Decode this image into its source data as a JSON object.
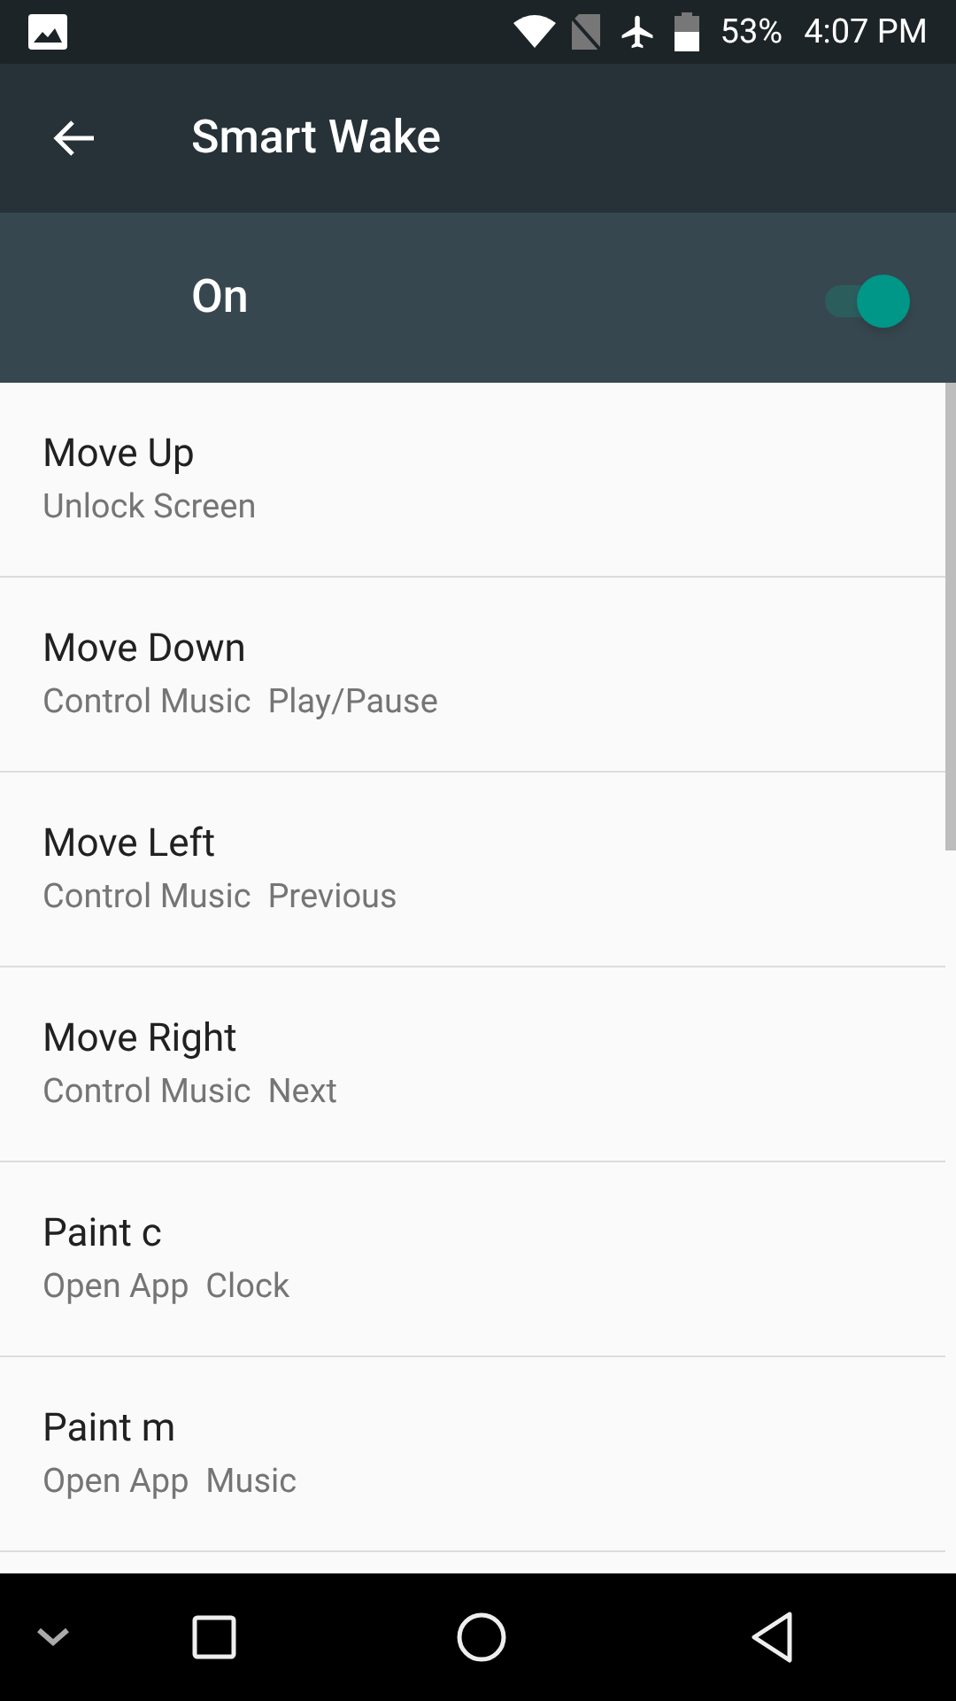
{
  "status_bar": {
    "battery": "53%",
    "time": "4:07 PM"
  },
  "app_bar": {
    "title": "Smart Wake"
  },
  "master_switch": {
    "label": "On",
    "on": true
  },
  "gestures": [
    {
      "title": "Move Up",
      "subtitle": "Unlock Screen"
    },
    {
      "title": "Move Down",
      "subtitle": "Control Music  Play/Pause"
    },
    {
      "title": "Move Left",
      "subtitle": "Control Music  Previous"
    },
    {
      "title": "Move Right",
      "subtitle": "Control Music  Next"
    },
    {
      "title": "Paint c",
      "subtitle": "Open App  Clock"
    },
    {
      "title": "Paint m",
      "subtitle": "Open App  Music"
    }
  ]
}
